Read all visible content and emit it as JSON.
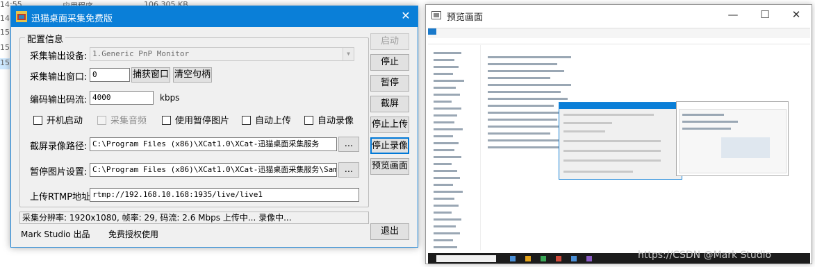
{
  "background": {
    "rows": [
      {
        "time": "14:55",
        "type": "应用程序",
        "size": "106,305 KB"
      },
      {
        "time": "14:57"
      },
      {
        "time": "15 1"
      },
      {
        "time": "15 1"
      },
      {
        "time": "15 9"
      }
    ]
  },
  "dialog": {
    "title": "迅猫桌面采集免费版",
    "close_glyph": "✕",
    "group_title": "配置信息",
    "device_label": "采集输出设备:",
    "device_value": "1.Generic PnP Monitor",
    "window_label": "采集输出窗口:",
    "window_value": "0",
    "capture_window_btn": "捕获窗口",
    "clear_handle_btn": "清空句柄",
    "bitrate_label": "编码输出码流:",
    "bitrate_value": "4000",
    "bitrate_unit": "kbps",
    "checkboxes": {
      "autostart": "开机启动",
      "audio": "采集音频",
      "pause_image": "使用暂停图片",
      "auto_upload": "自动上传",
      "auto_record": "自动录像"
    },
    "record_path_label": "截屏录像路径:",
    "record_path_value": "C:\\Program Files (x86)\\XCat1.0\\XCat-迅猫桌面采集服务",
    "pause_image_label": "暂停图片设置:",
    "pause_image_value": "C:\\Program Files (x86)\\XCat1.0\\XCat-迅猫桌面采集服务\\Sampl",
    "browse_label": "...",
    "rtmp_label": "上传RTMP地址:",
    "rtmp_value": "rtmp://192.168.10.168:1935/live/live1",
    "side_buttons": {
      "start": "启动",
      "stop": "停止",
      "pause": "暂停",
      "screenshot": "截屏",
      "stop_upload": "停止上传",
      "stop_record": "停止录像",
      "preview": "预览画面",
      "exit": "退出"
    },
    "status_text": "采集分辨率: 1920x1080, 帧率: 29, 码流: 2.6 Mbps  上传中...    录像中...",
    "brand": "Mark Studio 出品",
    "license": "免费授权使用"
  },
  "preview": {
    "title": "预览画面",
    "minimize_glyph": "—",
    "maximize_glyph": "☐",
    "close_glyph": "✕"
  },
  "watermark": "https://CSDN @Mark Studio"
}
